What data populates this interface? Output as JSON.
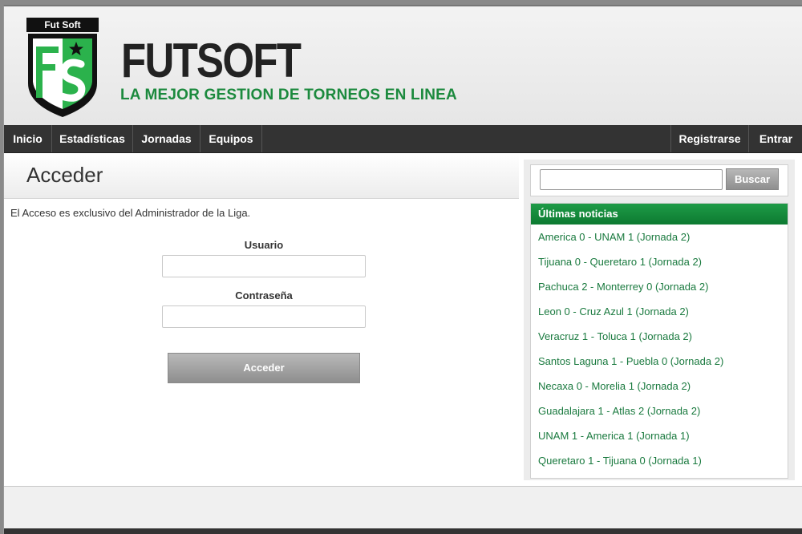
{
  "header": {
    "logo_text": "Fut Soft",
    "title": "FUTSOFT",
    "subtitle": "LA MEJOR GESTION DE TORNEOS EN LINEA"
  },
  "nav": {
    "left": [
      "Inicio",
      "Estadísticas",
      "Jornadas",
      "Equipos"
    ],
    "right": [
      "Registrarse",
      "Entrar"
    ]
  },
  "main": {
    "title": "Acceder",
    "intro": "El Acceso es exclusivo del Administrador de la Liga.",
    "form": {
      "user_label": "Usuario",
      "user_value": "",
      "password_label": "Contraseña",
      "password_value": "",
      "submit_label": "Acceder"
    }
  },
  "sidebar": {
    "search_value": "",
    "search_button": "Buscar",
    "news_title": "Últimas noticias",
    "news": [
      "America 0 - UNAM 1 (Jornada 2)",
      "Tijuana 0 - Queretaro 1 (Jornada 2)",
      "Pachuca 2 - Monterrey 0 (Jornada 2)",
      "Leon 0 - Cruz Azul 1 (Jornada 2)",
      "Veracruz 1 - Toluca 1 (Jornada 2)",
      "Santos Laguna 1 - Puebla 0 (Jornada 2)",
      "Necaxa 0 - Morelia 1 (Jornada 2)",
      "Guadalajara 1 - Atlas 2 (Jornada 2)",
      "UNAM 1 - America 1 (Jornada 1)",
      "Queretaro 1 - Tijuana 0 (Jornada 1)"
    ]
  },
  "colors": {
    "brand_green": "#1c8a3e",
    "nav_bg": "#333333",
    "news_header": "#0d7a31"
  }
}
